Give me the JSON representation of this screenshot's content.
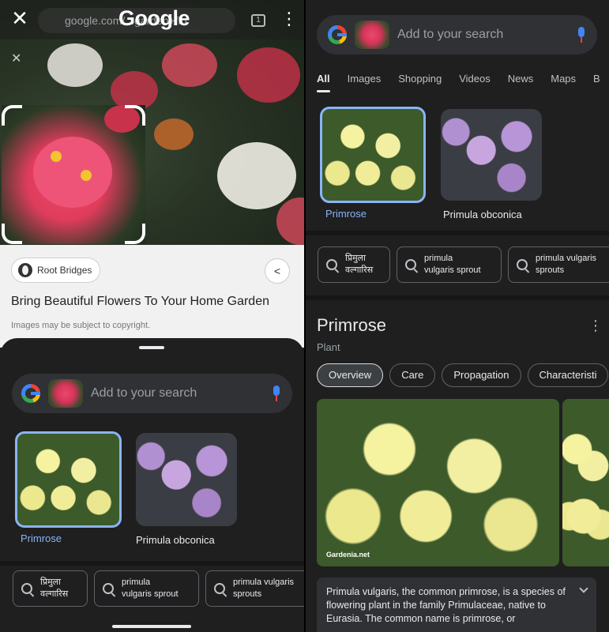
{
  "left": {
    "topbar": {
      "close_icon": "close-icon",
      "url_text": "google.com/...garden+flo",
      "logo_text": "Google",
      "tab_count": "1"
    },
    "source": {
      "site_name": "Root Bridges",
      "page_title": "Bring Beautiful Flowers To Your Home Garden",
      "copyright": "Images may be subject to copyright."
    },
    "search": {
      "placeholder": "Add to your search"
    },
    "results": [
      {
        "label": "Primrose",
        "selected": true
      },
      {
        "label": "Primula obconica",
        "selected": false
      }
    ],
    "suggestions": [
      {
        "text": "प्रिमुला\nवल्गारिस"
      },
      {
        "text": "primula\nvulgaris sprout"
      },
      {
        "text": "primula vulgaris\nsprouts"
      }
    ]
  },
  "right": {
    "search": {
      "placeholder": "Add to your search"
    },
    "tabs": [
      "All",
      "Images",
      "Shopping",
      "Videos",
      "News",
      "Maps",
      "B"
    ],
    "results": [
      {
        "label": "Primrose",
        "selected": true
      },
      {
        "label": "Primula obconica",
        "selected": false
      }
    ],
    "suggestions": [
      {
        "text": "प्रिमुला\nवल्गारिस"
      },
      {
        "text": "primula\nvulgaris sprout"
      },
      {
        "text": "primula vulgaris\nsprouts"
      }
    ],
    "knowledge_panel": {
      "title": "Primrose",
      "subtitle": "Plant",
      "tabs": [
        "Overview",
        "Care",
        "Propagation",
        "Characteristi"
      ],
      "image_watermark": "Gardenia.net",
      "description": "Primula vulgaris, the common primrose, is a species of flowering plant in the family Primulaceae, native to Eurasia. The common name is primrose, or"
    }
  },
  "colors": {
    "accent_blue": "#8ab4f8",
    "surface": "#1f1f1f",
    "searchbar": "#303134"
  }
}
